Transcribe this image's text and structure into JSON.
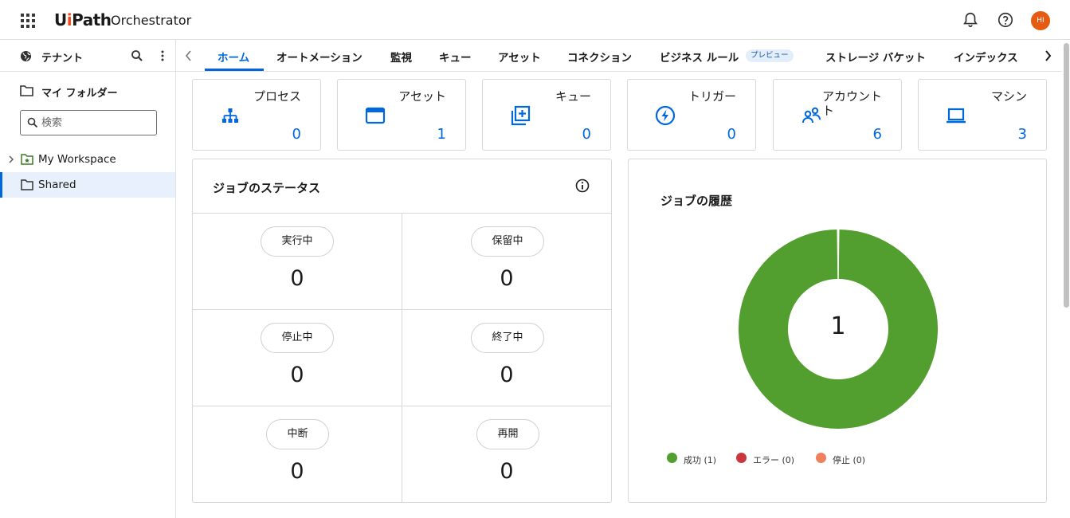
{
  "header": {
    "logo_text": "UiPath",
    "product": "Orchestrator",
    "avatar_initials": "HI",
    "icons": [
      "apps-grid-icon",
      "bell-icon",
      "help-icon"
    ]
  },
  "sidebar": {
    "tenant_label": "テナント",
    "my_folder_label": "マイ フォルダー",
    "search_placeholder": "検索",
    "tree": [
      {
        "label": "My Workspace",
        "selected": false,
        "expandable": true
      },
      {
        "label": "Shared",
        "selected": true,
        "expandable": false
      }
    ]
  },
  "tabs": [
    {
      "label": "ホーム",
      "active": true
    },
    {
      "label": "オートメーション"
    },
    {
      "label": "監視"
    },
    {
      "label": "キュー"
    },
    {
      "label": "アセット"
    },
    {
      "label": "コネクション"
    },
    {
      "label": "ビジネス ルール",
      "badge": "プレビュー"
    },
    {
      "label": "ストレージ バケット"
    },
    {
      "label": "インデックス"
    }
  ],
  "cards": [
    {
      "label": "プロセス",
      "value": "0",
      "icon": "process-tree-icon"
    },
    {
      "label": "アセット",
      "value": "1",
      "icon": "asset-window-icon"
    },
    {
      "label": "キュー",
      "value": "0",
      "icon": "queue-add-icon"
    },
    {
      "label": "トリガー",
      "value": "0",
      "icon": "trigger-bolt-icon"
    },
    {
      "label": "アカウント",
      "label2": "ト",
      "value": "6",
      "icon": "accounts-icon"
    },
    {
      "label": "マシン",
      "value": "3",
      "icon": "laptop-icon"
    }
  ],
  "job_status": {
    "title": "ジョブのステータス",
    "cells": [
      {
        "label": "実行中",
        "value": "0"
      },
      {
        "label": "保留中",
        "value": "0"
      },
      {
        "label": "停止中",
        "value": "0"
      },
      {
        "label": "終了中",
        "value": "0"
      },
      {
        "label": "中断",
        "value": "0"
      },
      {
        "label": "再開",
        "value": "0"
      }
    ]
  },
  "job_history": {
    "title": "ジョブの履歴",
    "total": "1",
    "legend": [
      {
        "label": "成功 (1)",
        "color": "#529e2e"
      },
      {
        "label": "エラー (0)",
        "color": "#c9363c"
      },
      {
        "label": "停止 (0)",
        "color": "#f07f5c"
      }
    ]
  },
  "chart_data": {
    "type": "pie",
    "categories": [
      "成功",
      "エラー",
      "停止"
    ],
    "values": [
      1,
      0,
      0
    ],
    "title": "ジョブの履歴"
  }
}
